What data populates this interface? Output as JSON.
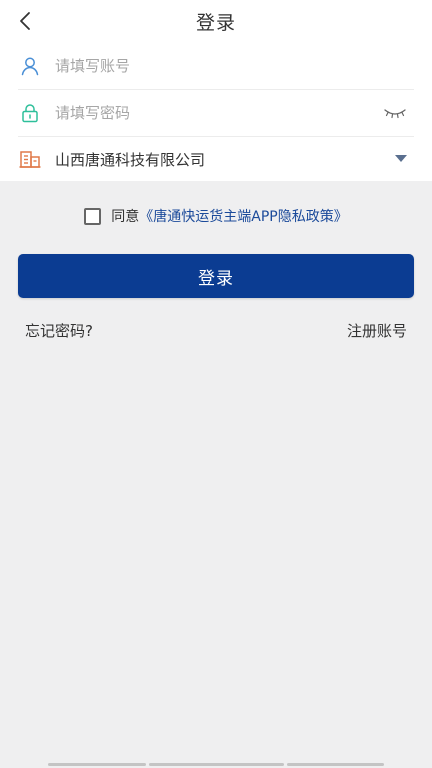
{
  "header": {
    "title": "登录",
    "back_icon": "chevron-left-icon"
  },
  "form": {
    "account": {
      "placeholder": "请填写账号",
      "value": ""
    },
    "password": {
      "placeholder": "请填写密码",
      "value": ""
    },
    "company": {
      "value": "山西唐通科技有限公司"
    }
  },
  "agreement": {
    "checked": false,
    "prefix": "同意",
    "policy_link": "《唐通快运货主端APP隐私政策》"
  },
  "actions": {
    "login_label": "登录",
    "forgot_label": "忘记密码?",
    "register_label": "注册账号"
  },
  "colors": {
    "primary": "#0b3c92",
    "account_icon": "#4a8fd6",
    "password_icon": "#2ebf9a",
    "company_icon": "#e07a4a",
    "link": "#1b4a9a"
  }
}
